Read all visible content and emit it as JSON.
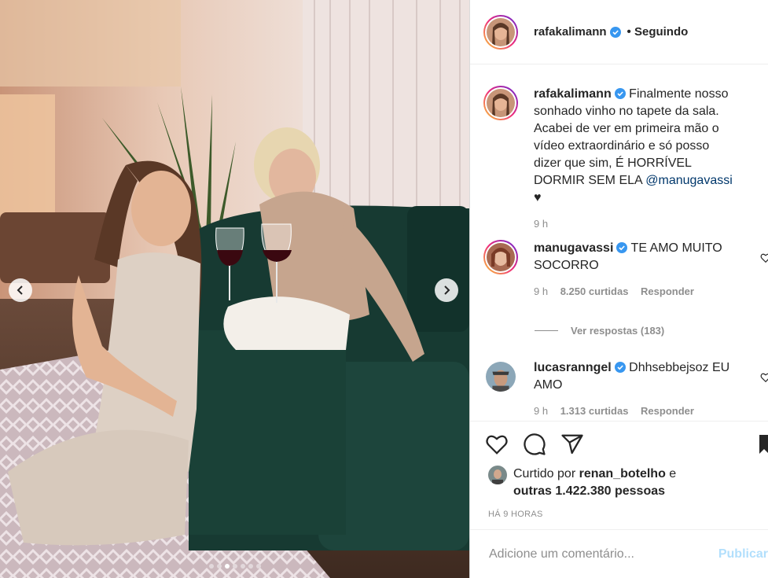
{
  "header": {
    "username": "rafakalimann",
    "follow_status": "• Seguindo"
  },
  "caption": {
    "username": "rafakalimann",
    "text": "Finalmente nosso sonhado vinho no tapete da sala. Acabei de ver em primeira mão o vídeo extraordinário e só posso dizer que sim, É HORRÍVEL DORMIR SEM ELA",
    "mention": "@manugavassi",
    "heart": "♥",
    "time": "9 h"
  },
  "comments": [
    {
      "username": "manugavassi",
      "text": "TE AMO MUITO SOCORRO",
      "time": "9 h",
      "likes": "8.250 curtidas",
      "reply": "Responder",
      "view_replies": "Ver respostas (183)"
    },
    {
      "username": "lucasranngel",
      "text": "Dhhsebbejsoz EU AMO",
      "time": "9 h",
      "likes": "1.313 curtidas",
      "reply": "Responder"
    }
  ],
  "likes_info": {
    "prefix": "Curtido por",
    "user": "renan_botelho",
    "joiner": "e",
    "others": "outras 1.422.380 pessoas"
  },
  "time_ago": "HÁ 9 HORAS",
  "add_comment": {
    "placeholder": "Adicione um comentário...",
    "publish": "Publicar"
  },
  "carousel": {
    "total": 7,
    "active_index": 2
  },
  "colors": {
    "verified": "#3897f0",
    "mention": "#00376b",
    "muted": "#8e8e8e",
    "publish_disabled": "#b2dffc"
  },
  "icons": [
    "verified-badge-icon",
    "heart-icon",
    "comment-icon",
    "share-icon",
    "bookmark-icon",
    "chevron-left-icon",
    "chevron-right-icon"
  ]
}
